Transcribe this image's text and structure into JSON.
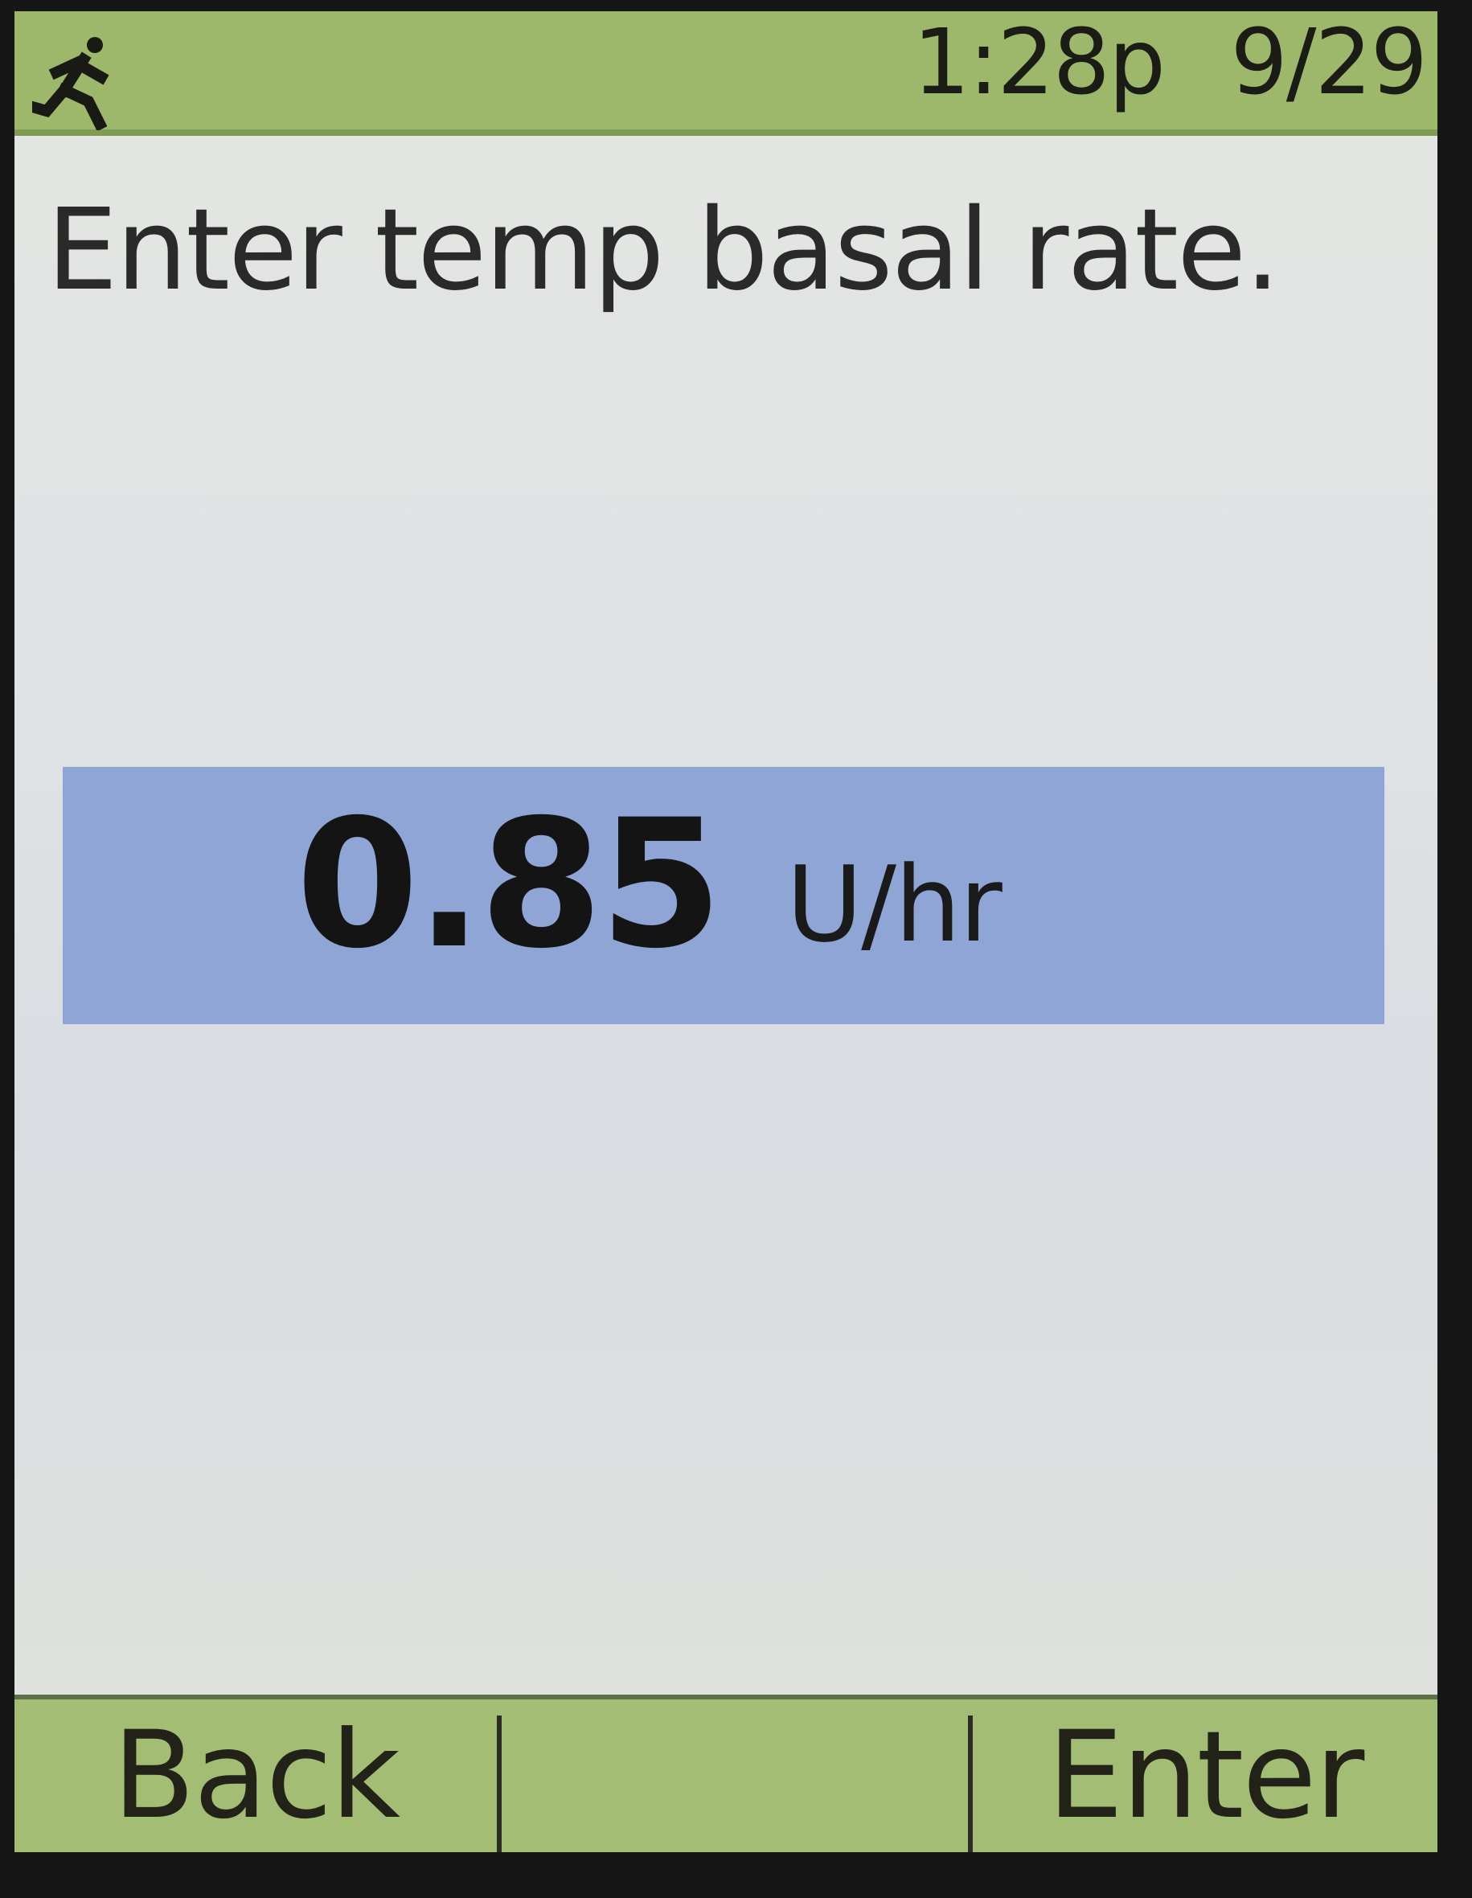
{
  "status_bar": {
    "activity_icon": "running-person-icon",
    "time": "1:28p",
    "date": "9/29",
    "color": "#9db86a"
  },
  "prompt": "Enter temp basal rate.",
  "value_field": {
    "value": "0.85",
    "unit": "U/hr",
    "highlight_color": "#8ea5d6"
  },
  "softkeys": {
    "left": "Back",
    "middle": "",
    "right": "Enter",
    "color": "#a3bd74"
  }
}
